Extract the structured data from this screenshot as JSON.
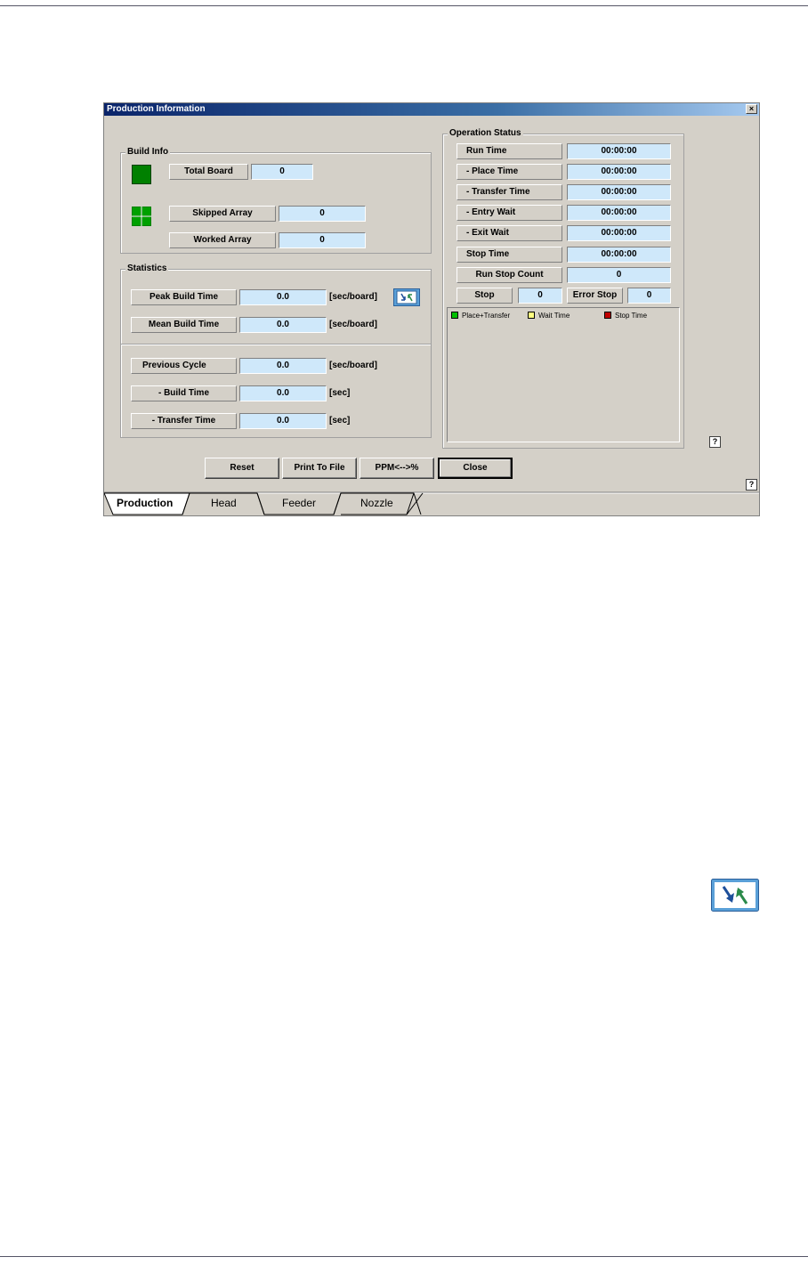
{
  "window": {
    "title": "Production Information",
    "close_glyph": "×"
  },
  "build_info": {
    "group_label": "Build Info",
    "total_board_label": "Total Board",
    "total_board_value": "0",
    "skipped_array_label": "Skipped Array",
    "skipped_array_value": "0",
    "worked_array_label": "Worked Array",
    "worked_array_value": "0",
    "board_icon": "board-icon",
    "array-icon": "array-icon",
    "board_color": "#008000"
  },
  "statistics": {
    "group_label": "Statistics",
    "peak_build_time_label": "Peak Build Time",
    "peak_build_time_value": "0.0",
    "peak_build_time_unit": "[sec/board]",
    "mean_build_time_label": "Mean Build Time",
    "mean_build_time_value": "0.0",
    "mean_build_time_unit": "[sec/board]",
    "previous_cycle_label": "Previous Cycle",
    "previous_cycle_value": "0.0",
    "previous_cycle_unit": "[sec/board]",
    "build_time_label": "- Build Time",
    "build_time_value": "0.0",
    "build_time_unit": "[sec]",
    "transfer_time_label": "- Transfer Time",
    "transfer_time_value": "0.0",
    "transfer_time_unit": "[sec]"
  },
  "operation_status": {
    "group_label": "Operation Status",
    "rows": [
      {
        "label": "Run Time",
        "value": "00:00:00"
      },
      {
        "label": "- Place Time",
        "value": "00:00:00"
      },
      {
        "label": "- Transfer Time",
        "value": "00:00:00"
      },
      {
        "label": "- Entry Wait",
        "value": "00:00:00"
      },
      {
        "label": "- Exit Wait",
        "value": "00:00:00"
      },
      {
        "label": "Stop Time",
        "value": "00:00:00"
      },
      {
        "label": "Run Stop Count",
        "value": "0"
      }
    ],
    "stop_label": "Stop",
    "stop_value": "0",
    "error_stop_label": "Error Stop",
    "error_stop_value": "0",
    "legend": [
      {
        "label": "Place+Transfer",
        "color": "#00c000"
      },
      {
        "label": "Wait Time",
        "color": "#ffff80"
      },
      {
        "label": "Stop Time",
        "color": "#c00000"
      }
    ]
  },
  "buttons": {
    "reset": "Reset",
    "print_to_file": "Print To File",
    "ppm_toggle": "PPM<-->%",
    "close": "Close",
    "help_glyph": "?"
  },
  "tabs": [
    {
      "label": "Production",
      "active": true
    },
    {
      "label": "Head",
      "active": false
    },
    {
      "label": "Feeder",
      "active": false
    },
    {
      "label": "Nozzle",
      "active": false
    }
  ],
  "colors": {
    "title_bar": "#0a246a",
    "value_field": "#cfe8fa",
    "window_face": "#d4d0c8",
    "refresh_icon": "#5aa0d8"
  }
}
